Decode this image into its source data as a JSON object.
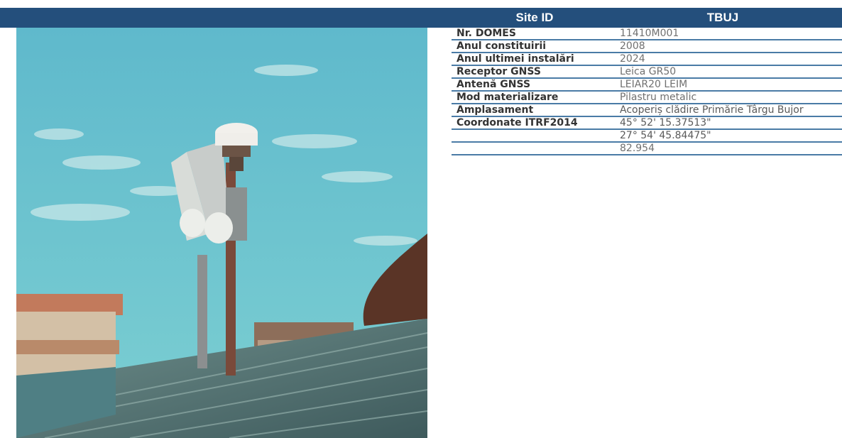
{
  "header": {
    "key": "Site ID",
    "value": "TBUJ"
  },
  "rows": [
    {
      "label": "Nr. DOMES",
      "value": "11410M001"
    },
    {
      "label": "Anul constituirii",
      "value": "2008"
    },
    {
      "label": "Anul ultimei instalări",
      "value": "2024"
    },
    {
      "label": "Receptor GNSS",
      "value": "Leica GR50"
    },
    {
      "label": "Antenă GNSS",
      "value": "LEIAR20 LEIM"
    },
    {
      "label": "Mod materializare",
      "value": "Pilastru metalic"
    },
    {
      "label": "Amplasament",
      "value": "Acoperiș clădire Primărie Târgu Bujor"
    },
    {
      "label": "Coordonate ITRF2014",
      "value": "45° 52' 15.37513\""
    },
    {
      "label": "",
      "value": "27° 54' 45.84475\""
    },
    {
      "label": "",
      "value": "82.954"
    }
  ],
  "colors": {
    "header_bg": "#244f7c",
    "row_border": "#4a7ba6",
    "sky": "#6cc3cf"
  },
  "photo": {
    "icon": "gnss-station-photo"
  }
}
